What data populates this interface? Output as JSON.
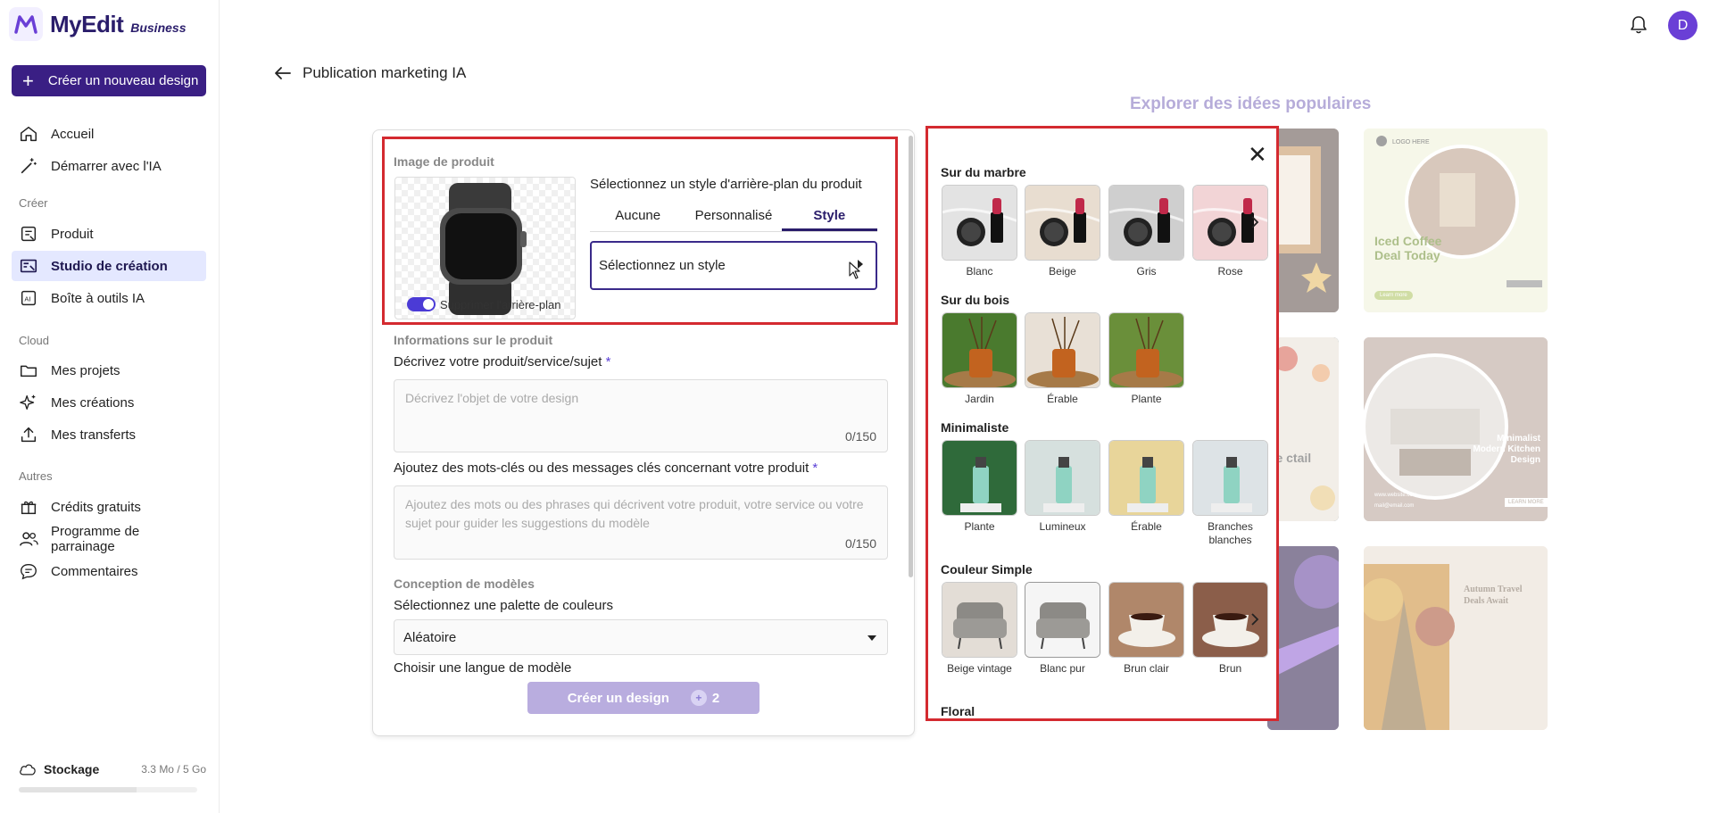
{
  "app": {
    "name": "MyEdit",
    "badge": "Business"
  },
  "sidebar": {
    "new_design": "Créer un nouveau design",
    "items_top": [
      {
        "label": "Accueil",
        "icon": "home-icon"
      },
      {
        "label": "Démarrer avec l'IA",
        "icon": "magic-wand-icon"
      }
    ],
    "section_create": "Créer",
    "items_create": [
      {
        "label": "Produit",
        "icon": "product-icon"
      },
      {
        "label": "Studio de création",
        "icon": "studio-icon",
        "active": true
      },
      {
        "label": "Boîte à outils IA",
        "icon": "ai-toolbox-icon"
      }
    ],
    "section_cloud": "Cloud",
    "items_cloud": [
      {
        "label": "Mes projets",
        "icon": "folder-icon"
      },
      {
        "label": "Mes créations",
        "icon": "sparkle-icon"
      },
      {
        "label": "Mes transferts",
        "icon": "upload-icon"
      }
    ],
    "section_other": "Autres",
    "items_other": [
      {
        "label": "Crédits gratuits",
        "icon": "gift-icon"
      },
      {
        "label": "Programme de parrainage",
        "icon": "users-icon"
      },
      {
        "label": "Commentaires",
        "icon": "comment-icon"
      }
    ],
    "storage_label": "Stockage",
    "storage_value": "3.3 Mo / 5 Go",
    "storage_fraction": 0.66
  },
  "header": {
    "avatar_letter": "D",
    "back_title": "Publication marketing IA"
  },
  "form": {
    "image_section": "Image de produit",
    "remove_bg_label": "Supprimer l'arrière-plan",
    "style_title": "Sélectionnez un style d'arrière-plan du produit",
    "tabs": [
      "Aucune",
      "Personnalisé",
      "Style"
    ],
    "active_tab": "Style",
    "style_select": "Sélectionnez un style",
    "info_section": "Informations sur le produit",
    "describe_label": "Décrivez votre produit/service/sujet",
    "describe_placeholder": "Décrivez l'objet de votre design",
    "describe_counter": "0/150",
    "keywords_label": "Ajoutez des mots-clés ou des messages clés concernant votre produit",
    "keywords_placeholder": "Ajoutez des mots ou des phrases qui décrivent votre produit, votre service ou votre sujet pour guider les suggestions du modèle",
    "keywords_counter": "0/150",
    "required_mark": "*",
    "template_section": "Conception de modèles",
    "palette_label": "Sélectionnez une palette de couleurs",
    "palette_value": "Aléatoire",
    "language_label": "Choisir une langue de modèle",
    "create_button": "Créer un design",
    "credit_cost": "2"
  },
  "explore": {
    "title": "Explorer des idées populaires",
    "card1": {
      "logo": "LOGO HERE",
      "title": "Iced Coffee Deal Today",
      "tag": "Learn more"
    },
    "card2": {
      "title": "Minimalist Modern Kitchen Design",
      "web": "www.website.com",
      "mail": "mail@email.com",
      "cta": "LEARN MORE"
    },
    "card3": {
      "title": "Autumn Travel Deals Await"
    },
    "partial_text": "re ctail"
  },
  "style_popup": {
    "categories": [
      {
        "title": "Sur du marbre",
        "items": [
          "Blanc",
          "Beige",
          "Gris",
          "Rose"
        ],
        "more": true
      },
      {
        "title": "Sur du bois",
        "items": [
          "Jardin",
          "Érable",
          "Plante"
        ],
        "more": false
      },
      {
        "title": "Minimaliste",
        "items": [
          "Plante",
          "Lumineux",
          "Érable",
          "Branches blanches"
        ],
        "more": false
      },
      {
        "title": "Couleur Simple",
        "items": [
          "Beige vintage",
          "Blanc pur",
          "Brun clair",
          "Brun"
        ],
        "more": true
      },
      {
        "title": "Floral",
        "items": [],
        "more": false
      }
    ]
  },
  "colors": {
    "brand": "#3a1f84",
    "accent": "#4b3bd6",
    "highlight": "#d42a30"
  }
}
